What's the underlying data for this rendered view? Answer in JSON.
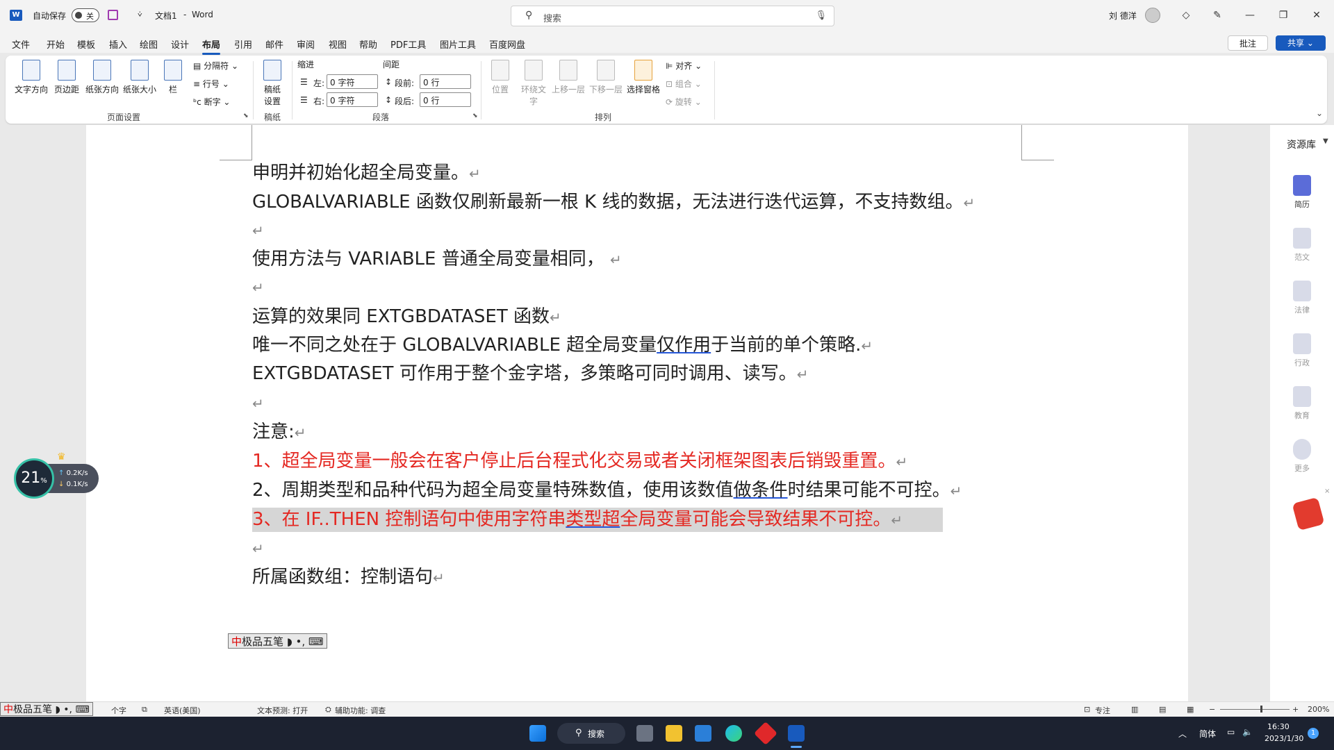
{
  "titlebar": {
    "autosave_label": "自动保存",
    "autosave_state": "关",
    "doc_title": "文档1",
    "separator": "-",
    "app_name": "Word",
    "search_placeholder": "搜索",
    "user_name": "刘 德洋"
  },
  "menu": {
    "tabs": [
      "文件",
      "开始",
      "模板",
      "插入",
      "绘图",
      "设计",
      "布局",
      "引用",
      "邮件",
      "审阅",
      "视图",
      "帮助",
      "PDF工具",
      "图片工具",
      "百度网盘"
    ],
    "active_tab": "布局",
    "comment_label": "批注",
    "share_label": "共享"
  },
  "ribbon": {
    "page_setup": {
      "text_direction": "文字方向",
      "margins": "页边距",
      "orientation": "纸张方向",
      "size": "纸张大小",
      "columns": "栏",
      "breaks": "分隔符",
      "line_numbers": "行号",
      "hyphenation": "断字",
      "group_label": "页面设置"
    },
    "manuscript": {
      "setup_line1": "稿纸",
      "setup_line2": "设置",
      "group_label": "稿纸"
    },
    "paragraph": {
      "indent_label": "缩进",
      "spacing_label": "间距",
      "left_label": "左:",
      "right_label": "右:",
      "before_label": "段前:",
      "after_label": "段后:",
      "left_value": "0 字符",
      "right_value": "0 字符",
      "before_value": "0 行",
      "after_value": "0 行",
      "group_label": "段落"
    },
    "arrange": {
      "position": "位置",
      "wrap_text_line1": "环绕文",
      "wrap_text_line2": "字",
      "bring_forward": "上移一层",
      "send_backward": "下移一层",
      "selection_pane": "选择窗格",
      "align": "对齐",
      "group": "组合",
      "rotate": "旋转",
      "group_label": "排列"
    }
  },
  "document": {
    "lines": [
      {
        "text": "申明并初始化超全局变量。"
      },
      {
        "text": "GLOBALVARIABLE 函数仅刷新最新一根 K 线的数据，无法进行迭代运算，不支持数组。"
      },
      {
        "text": ""
      },
      {
        "text": "使用方法与 VARIABLE 普通全局变量相同，"
      },
      {
        "text": ""
      },
      {
        "text": "运算的效果同 EXTGBDATASET 函数"
      },
      {
        "pre": "唯一不同之处在于 GLOBALVARIABLE 超全局变量",
        "u": "仅作用",
        "post": "于当前的单个策略."
      },
      {
        "text": "EXTGBDATASET 可作用于整个金字塔，多策略可同时调用、读写。"
      },
      {
        "text": ""
      },
      {
        "text": "注意:"
      },
      {
        "text": "1、超全局变量一般会在客户停止后台程式化交易或者关闭框架图表后销毁重置。",
        "color": "red"
      },
      {
        "pre": "2、周期类型和品种代码为超全局变量特殊数值，使用该数值",
        "u": "做条件",
        "post": "时结果可能不可控。"
      },
      {
        "pre": "3、在 IF..THEN 控制语句中使用字符串",
        "u": "类型超",
        "post": "全局变量可能会导致结果不可控。",
        "color": "red",
        "highlight": true
      },
      {
        "text": ""
      },
      {
        "text": "所属函数组：控制语句"
      }
    ],
    "paragraph_mark": "↵"
  },
  "ime_bar": {
    "name": "极品五笔"
  },
  "net_widget": {
    "percent": "21",
    "percent_unit": "%",
    "up_speed": "0.2",
    "down_speed": "0.1",
    "speed_unit": "K/s"
  },
  "right_pane": {
    "title": "资源库",
    "items": [
      "简历",
      "范文",
      "法律",
      "行政",
      "教育",
      "更多"
    ]
  },
  "statusbar": {
    "word_count": "个字",
    "language": "英语(美国)",
    "text_prediction": "文本预测: 打开",
    "accessibility": "辅助功能: 调查",
    "focus": "专注",
    "zoom": "200%"
  },
  "taskbar": {
    "search_label": "搜索",
    "ime_label": "简体",
    "time": "16:30",
    "date": "2023/1/30",
    "notification_count": "1"
  }
}
